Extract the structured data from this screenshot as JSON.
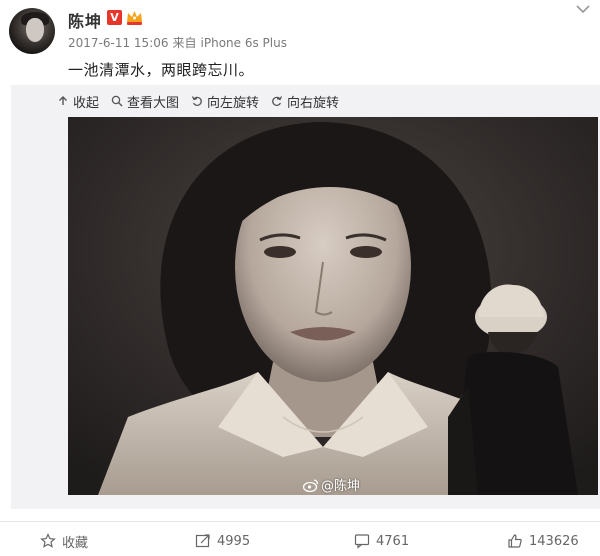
{
  "post": {
    "author": "陈坤",
    "vip_badge": "V",
    "date": "2017-6-11 15:06",
    "source_prefix": "来自",
    "device": "iPhone 6s Plus",
    "text": "一池清潭水，两眼跨忘川。"
  },
  "toolbar": {
    "collapse": "收起",
    "view_large": "查看大图",
    "rotate_left": "向左旋转",
    "rotate_right": "向右旋转"
  },
  "watermark": "@陈坤",
  "actions": {
    "favorite": "收藏",
    "repost_count": "4995",
    "comment_count": "4761",
    "like_count": "143626"
  },
  "colors": {
    "vip": "#e8352b",
    "text": "#333333",
    "meta": "#7a7a7a",
    "media_bg": "#f2f2f5"
  }
}
